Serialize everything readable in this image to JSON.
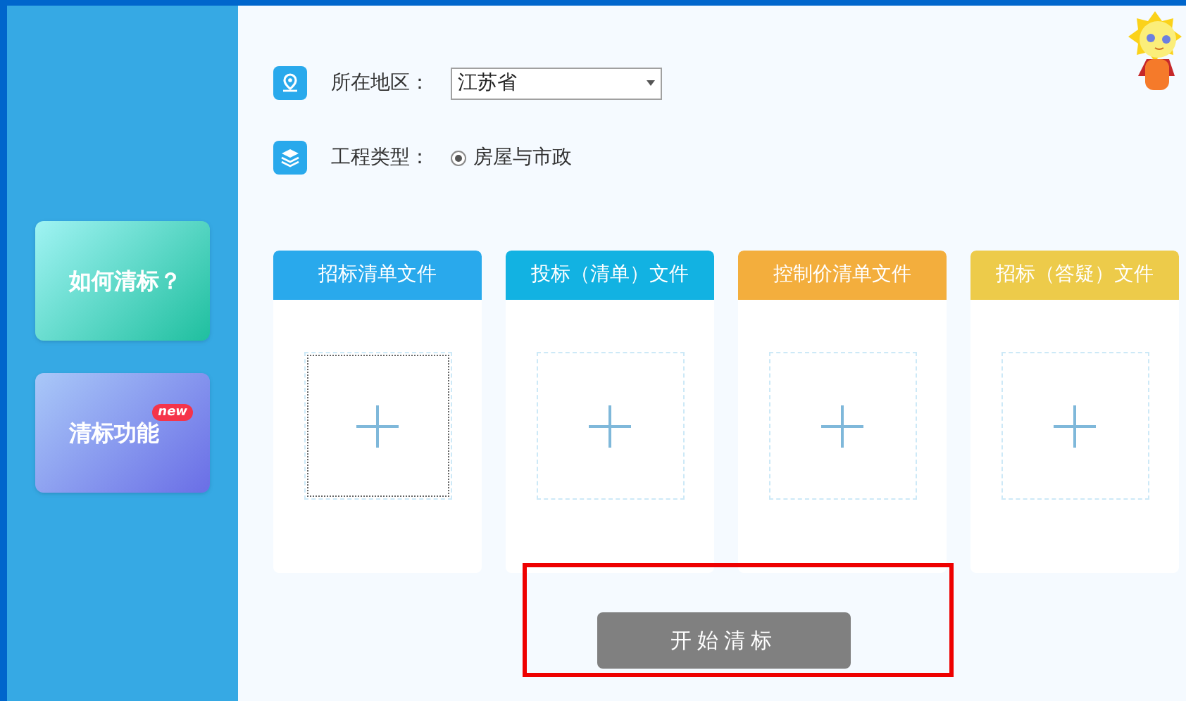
{
  "sidebar": {
    "items": [
      {
        "label": "如何清标？",
        "kind": "guide"
      },
      {
        "label": "清标功能",
        "kind": "feature",
        "badge": "new"
      }
    ]
  },
  "form": {
    "region": {
      "label": "所在地区：",
      "value": "江苏省"
    },
    "project_type": {
      "label": "工程类型：",
      "options": [
        {
          "label": "房屋与市政",
          "selected": true
        }
      ]
    }
  },
  "upload_cards": [
    {
      "title": "招标清单文件",
      "color": "#29a9ec",
      "focused": true
    },
    {
      "title": "投标（清单）文件",
      "color": "#12b2e2",
      "focused": false
    },
    {
      "title": "控制价清单文件",
      "color": "#f3ae3d",
      "focused": false
    },
    {
      "title": "招标（答疑）文件",
      "color": "#edcb4a",
      "focused": false
    }
  ],
  "start_button": {
    "label": "开始清标"
  }
}
